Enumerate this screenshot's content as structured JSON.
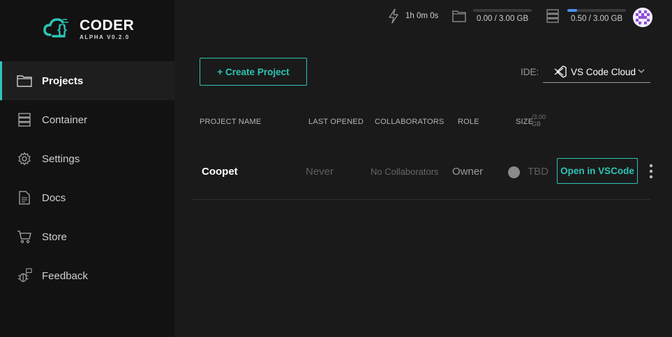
{
  "brand": {
    "title": "CODER",
    "version": "ALPHA V0.2.0"
  },
  "sidebar": {
    "items": [
      {
        "label": "Projects",
        "icon": "folder-icon",
        "active": true
      },
      {
        "label": "Container",
        "icon": "server-icon",
        "active": false
      },
      {
        "label": "Settings",
        "icon": "gear-icon",
        "active": false
      },
      {
        "label": "Docs",
        "icon": "document-icon",
        "active": false
      },
      {
        "label": "Store",
        "icon": "cart-icon",
        "active": false
      },
      {
        "label": "Feedback",
        "icon": "bug-icon",
        "active": false
      }
    ]
  },
  "topbar": {
    "timer": "1h 0m 0s",
    "storage": {
      "text": "0.00 / 3.00 GB",
      "fraction": 0.0
    },
    "container": {
      "text": "0.50 / 3.00 GB",
      "fraction": 0.1667
    }
  },
  "toolbar": {
    "create_label": "+ Create Project",
    "ide_label": "IDE:",
    "ide_value": "VS Code Cloud"
  },
  "table": {
    "headers": {
      "name": "PROJECT NAME",
      "last_opened": "LAST OPENED",
      "collaborators": "COLLABORATORS",
      "role": "ROLE",
      "size": "SIZE",
      "size_sup_1": "/3.00",
      "size_sup_2": "GB"
    },
    "rows": [
      {
        "name": "Coopet",
        "last_opened": "Never",
        "collaborators": "No Collaborators",
        "role": "Owner",
        "size": "TBD",
        "action": "Open in VSCode"
      }
    ]
  },
  "colors": {
    "accent": "#2ec4b6",
    "bar": "#4b8ef0",
    "sidebar_bg": "#121212",
    "main_bg": "#1a1a1a"
  }
}
